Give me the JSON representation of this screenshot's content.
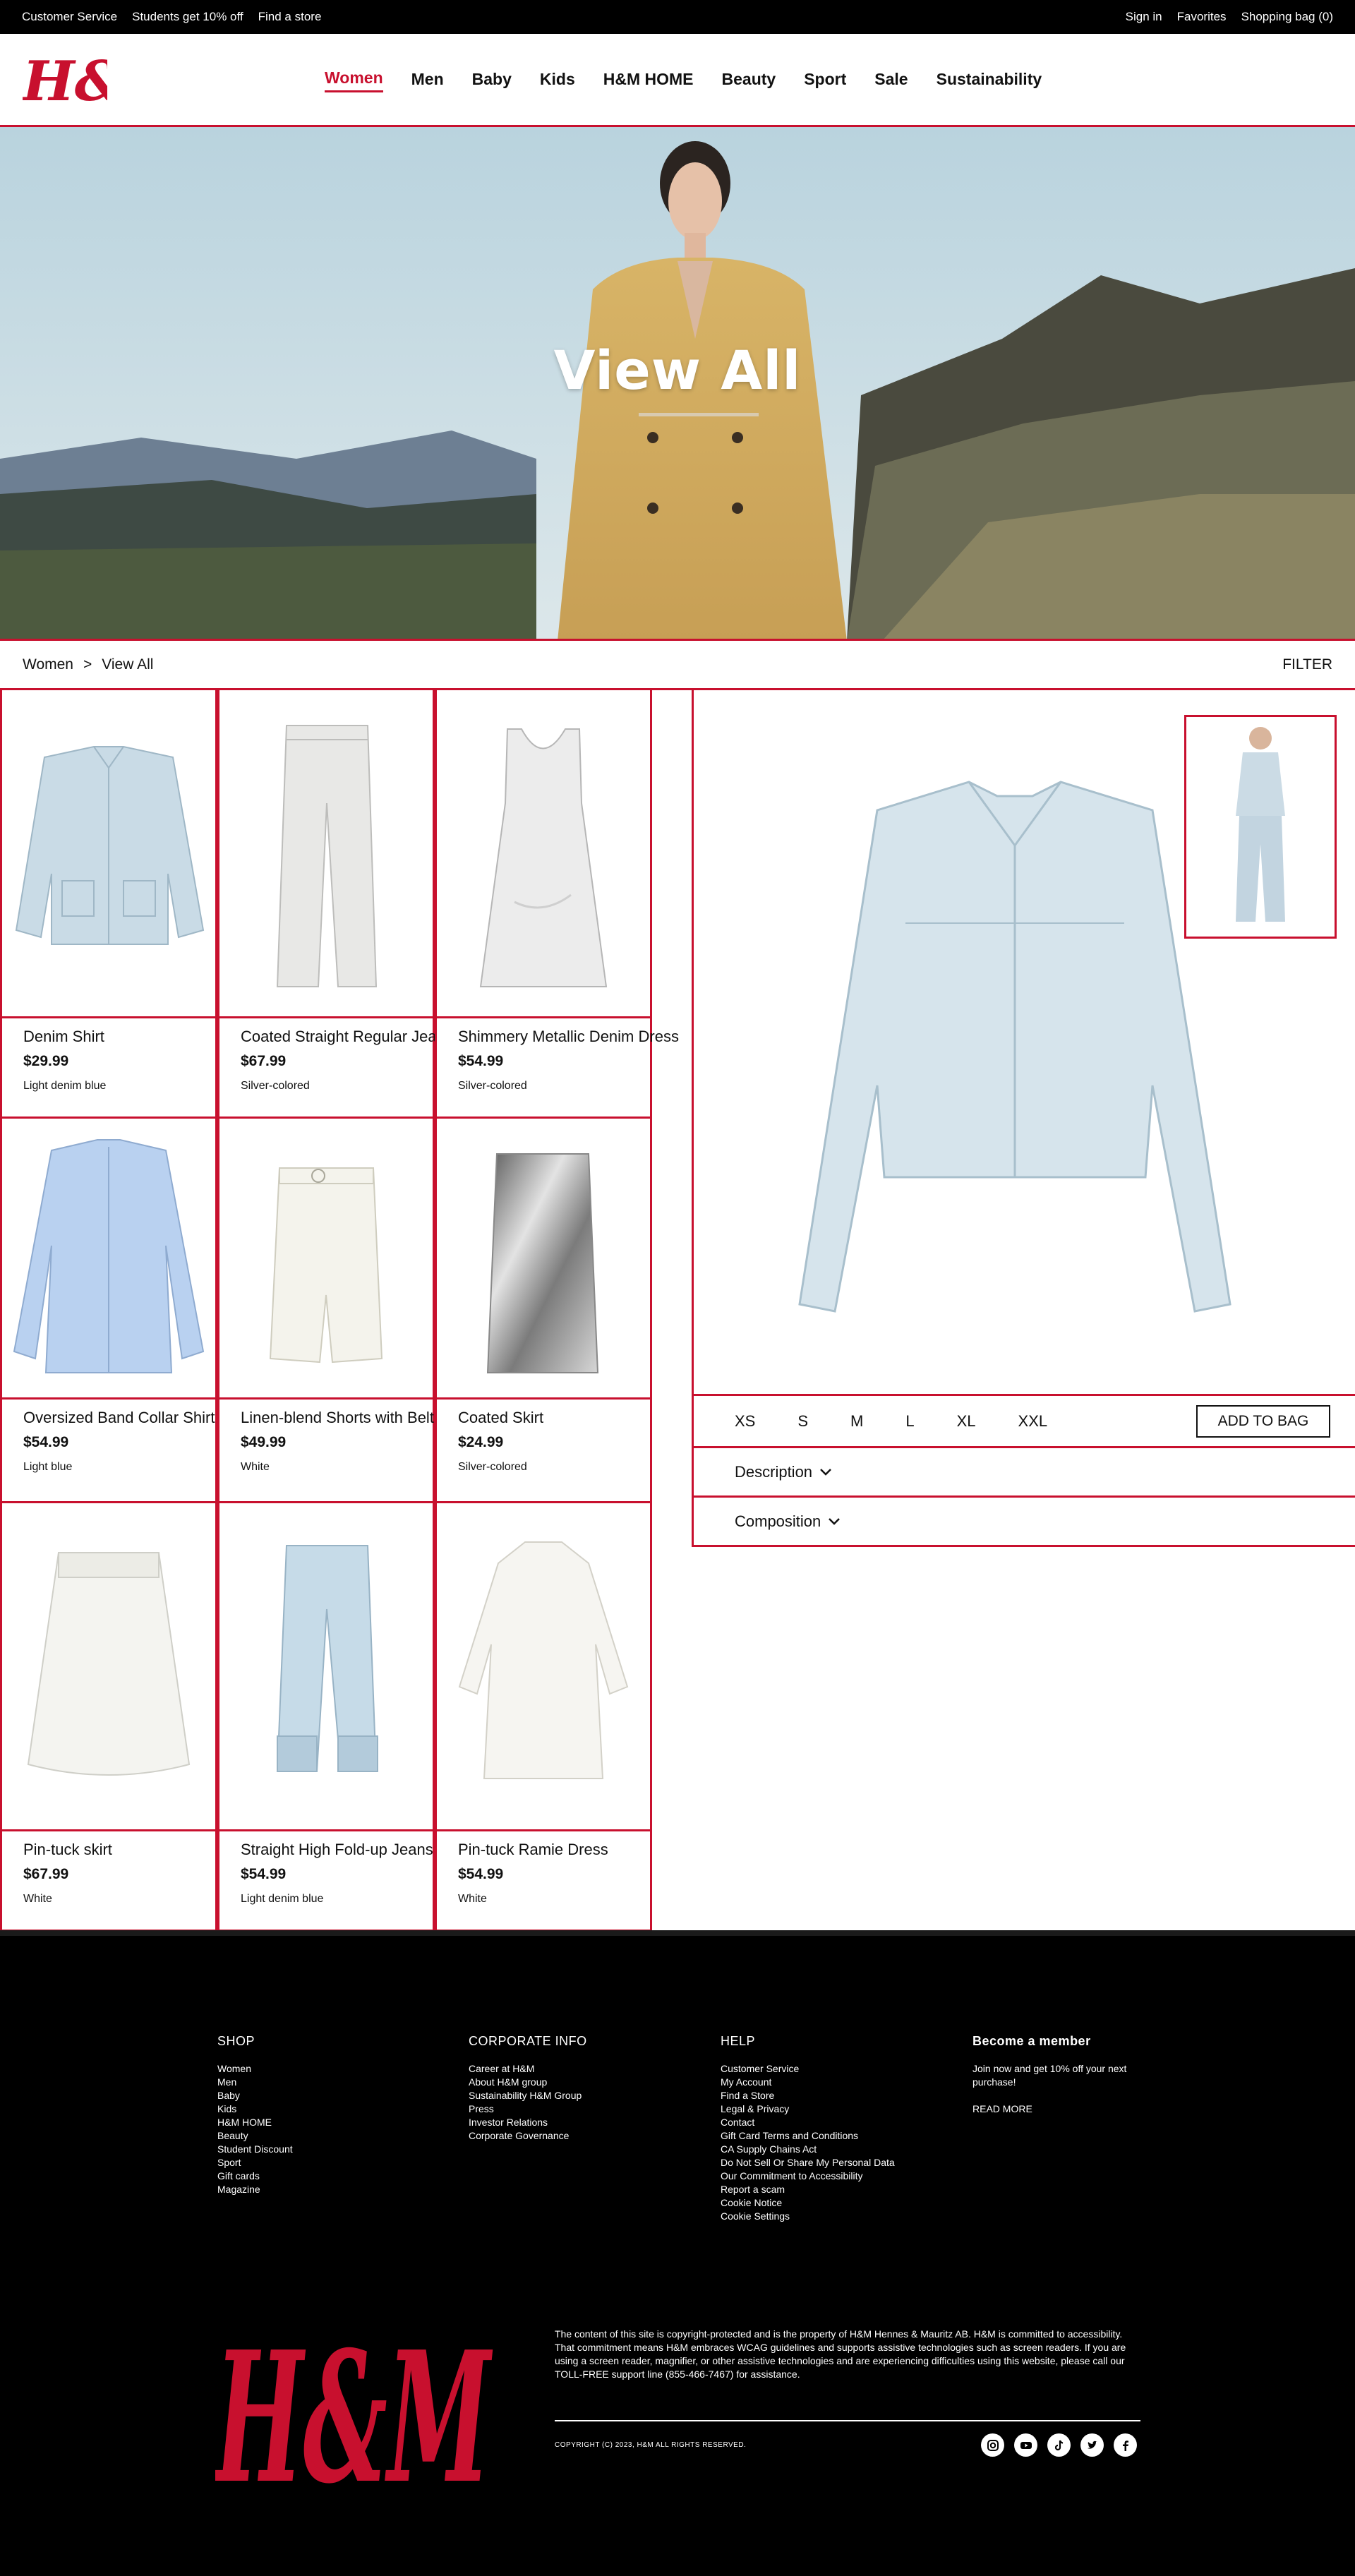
{
  "topbar": {
    "left": [
      "Customer Service",
      "Students get 10% off",
      "Find a store"
    ],
    "sign_in": "Sign in",
    "favorites": "Favorites",
    "shopping_bag": "Shopping bag (0)"
  },
  "brand": {
    "logo_text": "H&M",
    "color": "#c8102e"
  },
  "nav": [
    "Women",
    "Men",
    "Baby",
    "Kids",
    "H&M HOME",
    "Beauty",
    "Sport",
    "Sale",
    "Sustainability"
  ],
  "hero": {
    "title": "View All"
  },
  "breadcrumb": {
    "section": "Women",
    "separator": ">",
    "page": "View All",
    "filter": "FILTER"
  },
  "products": [
    {
      "name": "Denim Shirt",
      "price": "$29.99",
      "color": "Light denim blue"
    },
    {
      "name": "Coated Straight Regular Jeans",
      "price": "$67.99",
      "color": "Silver-colored"
    },
    {
      "name": "Shimmery Metallic Denim Dress",
      "price": "$54.99",
      "color": "Silver-colored"
    },
    {
      "name": "Oversized Band Collar Shirt",
      "price": "$54.99",
      "color": "Light blue"
    },
    {
      "name": "Linen-blend Shorts with Belt",
      "price": "$49.99",
      "color": "White"
    },
    {
      "name": "Coated Skirt",
      "price": "$24.99",
      "color": "Silver-colored"
    },
    {
      "name": "Pin-tuck skirt",
      "price": "$67.99",
      "color": "White"
    },
    {
      "name": "Straight High Fold-up Jeans",
      "price": "$54.99",
      "color": "Light denim blue"
    },
    {
      "name": "Pin-tuck Ramie Dress",
      "price": "$54.99",
      "color": "White"
    }
  ],
  "detail": {
    "sizes": [
      "XS",
      "S",
      "M",
      "L",
      "XL",
      "XXL"
    ],
    "add_to_bag": "ADD TO BAG",
    "description": "Description",
    "composition": "Composition"
  },
  "footer": {
    "shop": {
      "title": "SHOP",
      "items": [
        "Women",
        "Men",
        "Baby",
        "Kids",
        "H&M HOME",
        "Beauty",
        "Student Discount",
        "Sport",
        "Gift cards",
        "Magazine"
      ]
    },
    "corporate": {
      "title": "CORPORATE INFO",
      "items": [
        "Career at H&M",
        "About H&M group",
        "Sustainability H&M Group",
        "Press",
        "Investor Relations",
        "Corporate Governance"
      ]
    },
    "help": {
      "title": "HELP",
      "items": [
        "Customer Service",
        "My Account",
        "Find a Store",
        "Legal & Privacy",
        "Contact",
        "Gift Card Terms and Conditions",
        "CA Supply Chains Act",
        "Do Not Sell Or Share My Personal Data",
        "Our Commitment to Accessibility",
        "Report a scam",
        "Cookie Notice",
        "Cookie Settings"
      ]
    },
    "member": {
      "title": "Become a member",
      "text": "Join now and get 10% off your next purchase!",
      "read_more": "READ MORE"
    },
    "legal": "The content of this site is copyright-protected and is the property of H&M Hennes & Mauritz AB. H&M is committed to accessibility. That commitment means H&M embraces WCAG guidelines and supports assistive technologies such as screen readers. If you are using a screen reader, magnifier, or other assistive technologies and are experiencing difficulties using this website, please call our TOLL-FREE support line (855-466-7467) for assistance.",
    "copyright": "COPYRIGHT (C) 2023, H&M ALL RIGHTS RESERVED.",
    "social_icons": [
      "instagram-icon",
      "youtube-icon",
      "tiktok-icon",
      "twitter-icon",
      "facebook-icon"
    ]
  }
}
